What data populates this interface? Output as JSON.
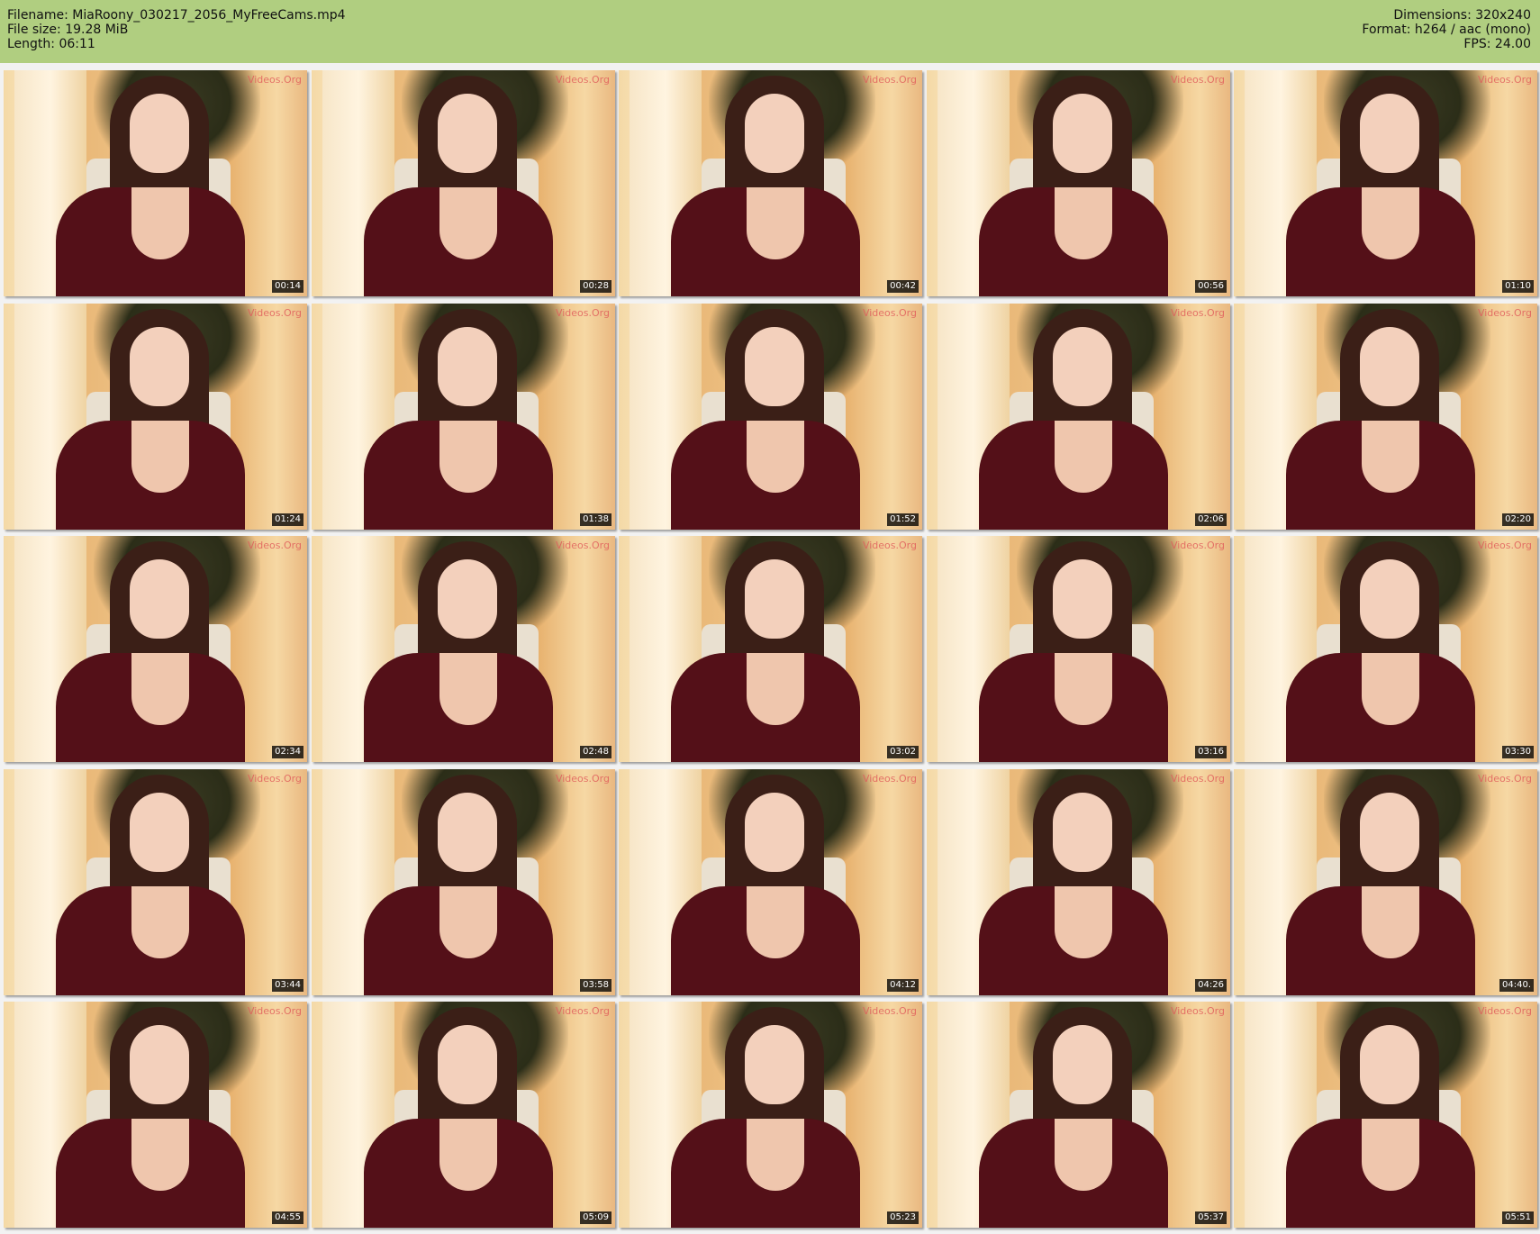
{
  "header": {
    "filename_label": "Filename: MiaRoony_030217_2056_MyFreeCams.mp4",
    "filesize_label": "File size: 19.28 MiB",
    "length_label": "Length: 06:11",
    "dimensions_label": "Dimensions: 320x240",
    "format_label": "Format: h264 / aac (mono)",
    "fps_label": "FPS: 24.00"
  },
  "thumbnails": [
    {
      "timestamp": "00:14",
      "watermark": "Videos.Org"
    },
    {
      "timestamp": "00:28",
      "watermark": "Videos.Org"
    },
    {
      "timestamp": "00:42",
      "watermark": "Videos.Org"
    },
    {
      "timestamp": "00:56",
      "watermark": "Videos.Org"
    },
    {
      "timestamp": "01:10",
      "watermark": "Videos.Org"
    },
    {
      "timestamp": "01:24",
      "watermark": "Videos.Org"
    },
    {
      "timestamp": "01:38",
      "watermark": "Videos.Org"
    },
    {
      "timestamp": "01:52",
      "watermark": "Videos.Org"
    },
    {
      "timestamp": "02:06",
      "watermark": "Videos.Org"
    },
    {
      "timestamp": "02:20",
      "watermark": "Videos.Org"
    },
    {
      "timestamp": "02:34",
      "watermark": "Videos.Org"
    },
    {
      "timestamp": "02:48",
      "watermark": "Videos.Org"
    },
    {
      "timestamp": "03:02",
      "watermark": "Videos.Org"
    },
    {
      "timestamp": "03:16",
      "watermark": "Videos.Org"
    },
    {
      "timestamp": "03:30",
      "watermark": "Videos.Org"
    },
    {
      "timestamp": "03:44",
      "watermark": "Videos.Org"
    },
    {
      "timestamp": "03:58",
      "watermark": "Videos.Org"
    },
    {
      "timestamp": "04:12",
      "watermark": "Videos.Org"
    },
    {
      "timestamp": "04:26",
      "watermark": "Videos.Org"
    },
    {
      "timestamp": "04:40.",
      "watermark": "Videos.Org"
    },
    {
      "timestamp": "04:55",
      "watermark": "Videos.Org"
    },
    {
      "timestamp": "05:09",
      "watermark": "Videos.Org"
    },
    {
      "timestamp": "05:23",
      "watermark": "Videos.Org"
    },
    {
      "timestamp": "05:37",
      "watermark": "Videos.Org"
    },
    {
      "timestamp": "05:51",
      "watermark": "Videos.Org"
    }
  ],
  "colors": {
    "header_bg": "#b0ce80",
    "page_bg": "#f2f2f2",
    "timestamp_bg": "#000000",
    "timestamp_text": "#ffffff"
  }
}
